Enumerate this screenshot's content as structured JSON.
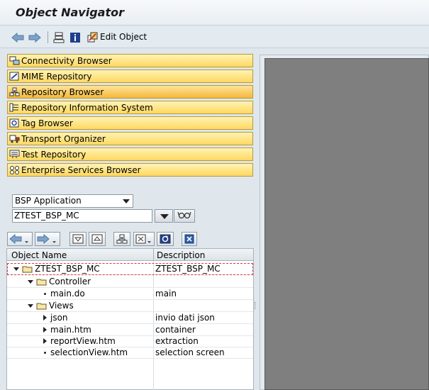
{
  "window": {
    "title": "Object Navigator"
  },
  "toolbar": {
    "icons": [
      "back-arrow-icon",
      "forward-arrow-icon",
      "hierarchy-icon",
      "info-icon",
      "edit-object-icon"
    ],
    "edit_label": "Edit Object"
  },
  "nav": {
    "items": [
      {
        "label": "Connectivity Browser",
        "icon": "connectivity-icon"
      },
      {
        "label": "MIME Repository",
        "icon": "mime-icon"
      },
      {
        "label": "Repository Browser",
        "icon": "repository-icon",
        "active": true
      },
      {
        "label": "Repository Information System",
        "icon": "info-system-icon"
      },
      {
        "label": "Tag Browser",
        "icon": "tag-icon"
      },
      {
        "label": "Transport Organizer",
        "icon": "truck-icon"
      },
      {
        "label": "Test Repository",
        "icon": "test-icon"
      },
      {
        "label": "Enterprise Services Browser",
        "icon": "services-icon"
      }
    ]
  },
  "object_type": {
    "selected": "BSP Application"
  },
  "object_name": {
    "value": "ZTEST_BSP_MC"
  },
  "tree": {
    "headers": {
      "name": "Object Name",
      "description": "Description"
    },
    "rows": [
      {
        "name": "ZTEST_BSP_MC",
        "description": "ZTEST_BSP_MC",
        "level": 0,
        "toggle": "expanded",
        "folder": true,
        "selected": true
      },
      {
        "name": "Controller",
        "description": "",
        "level": 1,
        "toggle": "expanded",
        "folder": true
      },
      {
        "name": "main.do",
        "description": "main",
        "level": 2,
        "toggle": "leaf",
        "folder": false
      },
      {
        "name": "Views",
        "description": "",
        "level": 1,
        "toggle": "expanded",
        "folder": true
      },
      {
        "name": "json",
        "description": "invio dati json",
        "level": 2,
        "toggle": "collapsed",
        "folder": false
      },
      {
        "name": "main.htm",
        "description": "container",
        "level": 2,
        "toggle": "collapsed",
        "folder": false
      },
      {
        "name": "reportView.htm",
        "description": "extraction",
        "level": 2,
        "toggle": "collapsed",
        "folder": false
      },
      {
        "name": "selectionView.htm",
        "description": "selection screen",
        "level": 2,
        "toggle": "leaf",
        "folder": false
      }
    ]
  },
  "colors": {
    "nav_button": "#ffd860",
    "nav_active": "#f4b83a",
    "background": "#dfe6ec",
    "content_area": "#7f7f7f"
  }
}
